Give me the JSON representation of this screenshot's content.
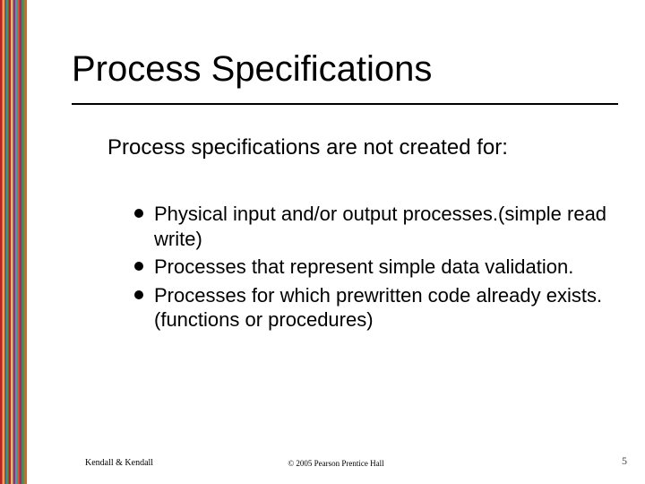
{
  "title": "Process Specifications",
  "intro": "Process specifications are not created for:",
  "bullets": [
    "Physical input and/or output processes.(simple read write)",
    "Processes that represent simple data validation.",
    "Processes for which prewritten code already exists.(functions or procedures)"
  ],
  "footer": {
    "left": "Kendall & Kendall",
    "center": "© 2005 Pearson Prentice Hall",
    "right": "5"
  }
}
